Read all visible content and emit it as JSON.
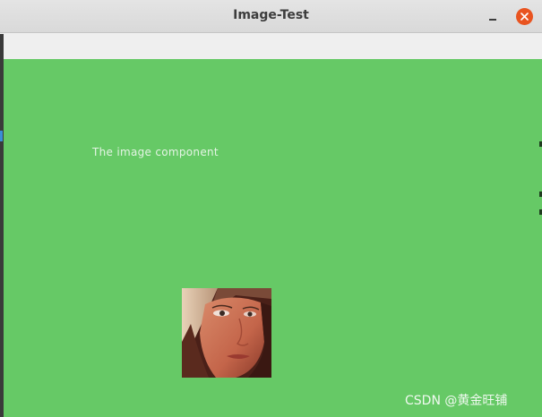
{
  "window": {
    "title": "Image-Test",
    "minimize_label": "–",
    "close_label": "×"
  },
  "canvas": {
    "background": "#66c966",
    "label": "The image component"
  },
  "image": {
    "kind": "portrait photo"
  },
  "watermark": {
    "text": "CSDN @黄金旺铺"
  },
  "colors": {
    "close_button": "#e95420",
    "label_text": "#e4f4e4"
  }
}
